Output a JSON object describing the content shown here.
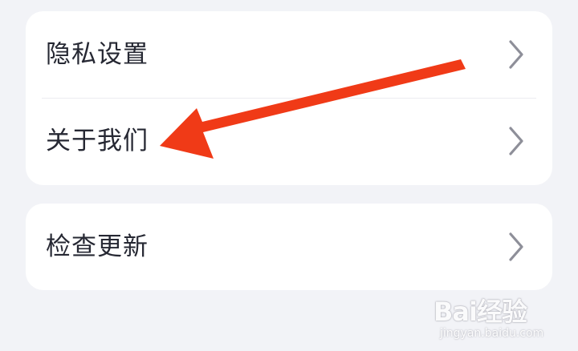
{
  "settings_list": {
    "group_1": {
      "items": [
        {
          "label": "隐私设置",
          "icon": "chevron-right-icon"
        },
        {
          "label": "关于我们",
          "icon": "chevron-right-icon"
        }
      ]
    },
    "group_2": {
      "items": [
        {
          "label": "检查更新",
          "icon": "chevron-right-icon"
        }
      ]
    }
  },
  "annotation": {
    "type": "arrow",
    "color": "#f03a17",
    "points_to": "关于我们"
  },
  "watermark": {
    "brand": "Bai经验",
    "site": "jingyan.baidu.com"
  },
  "colors": {
    "background": "#f2f3f7",
    "card": "#ffffff",
    "text": "#262833",
    "chevron": "#8e8f99",
    "divider": "#ececf1"
  }
}
